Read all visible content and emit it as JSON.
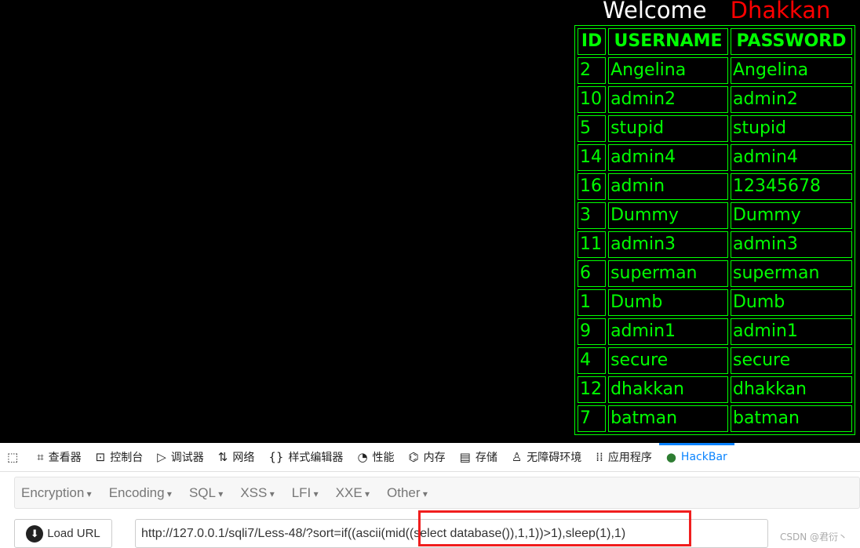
{
  "page": {
    "welcome": "Welcome",
    "user": "Dhakkan",
    "headers": [
      "ID",
      "USERNAME",
      "PASSWORD"
    ],
    "rows": [
      [
        "2",
        "Angelina",
        "Angelina"
      ],
      [
        "10",
        "admin2",
        "admin2"
      ],
      [
        "5",
        "stupid",
        "stupid"
      ],
      [
        "14",
        "admin4",
        "admin4"
      ],
      [
        "16",
        "admin",
        "12345678"
      ],
      [
        "3",
        "Dummy",
        "Dummy"
      ],
      [
        "11",
        "admin3",
        "admin3"
      ],
      [
        "6",
        "superman",
        "superman"
      ],
      [
        "1",
        "Dumb",
        "Dumb"
      ],
      [
        "9",
        "admin1",
        "admin1"
      ],
      [
        "4",
        "secure",
        "secure"
      ],
      [
        "12",
        "dhakkan",
        "dhakkan"
      ],
      [
        "7",
        "batman",
        "batman"
      ]
    ]
  },
  "devtools": {
    "tabs": [
      {
        "icon": "inspector-icon",
        "label": "查看器"
      },
      {
        "icon": "console-icon",
        "label": "控制台"
      },
      {
        "icon": "debugger-icon",
        "label": "调试器"
      },
      {
        "icon": "network-icon",
        "label": "网络"
      },
      {
        "icon": "style-editor-icon",
        "label": "样式编辑器"
      },
      {
        "icon": "performance-icon",
        "label": "性能"
      },
      {
        "icon": "memory-icon",
        "label": "内存"
      },
      {
        "icon": "storage-icon",
        "label": "存储"
      },
      {
        "icon": "accessibility-icon",
        "label": "无障碍环境"
      },
      {
        "icon": "application-icon",
        "label": "应用程序"
      },
      {
        "icon": "hackbar-icon",
        "label": "HackBar",
        "active": true
      }
    ]
  },
  "hackbar": {
    "menus": [
      "Encryption",
      "Encoding",
      "SQL",
      "XSS",
      "LFI",
      "XXE",
      "Other"
    ],
    "load_url": "Load URL",
    "url": "http://127.0.0.1/sqli7/Less-48/?sort=if((ascii(mid((select database()),1,1))>1),sleep(1),1)"
  },
  "watermark": "CSDN @君衍丶",
  "colors": {
    "table": "#00ff00",
    "user": "#ff0000",
    "active_tab": "#0a84ff",
    "highlight": "#f01e1e"
  }
}
